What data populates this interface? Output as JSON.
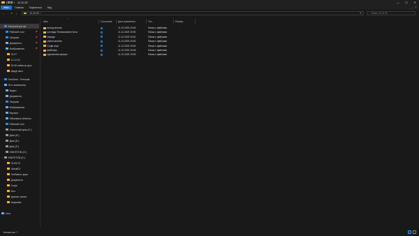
{
  "window": {
    "title": "11.12.23",
    "controls": [
      "—",
      "☐",
      "✕"
    ]
  },
  "ribbon": {
    "tabs": [
      "Файл",
      "Главная",
      "Поделиться",
      "Вид"
    ],
    "right_icons": [
      "chevron-down-icon",
      "help-icon"
    ]
  },
  "address": {
    "path": "11.12.23",
    "search_placeholder": "Поиск: 11.12.23"
  },
  "nav": {
    "items": [
      {
        "label": "Быстрый доступ",
        "icon": "star-icon",
        "color": "#3b8bd6",
        "selected": true,
        "pinned": false
      },
      {
        "label": "Рабочий стол",
        "icon": "desktop-icon",
        "color": "#3b8bd6",
        "pinned": true
      },
      {
        "label": "Загрузки",
        "icon": "download-icon",
        "color": "#3b8bd6",
        "pinned": true
      },
      {
        "label": "Документы",
        "icon": "document-icon",
        "color": "#9ab0c8",
        "pinned": true
      },
      {
        "label": "Изображения",
        "icon": "pictures-icon",
        "color": "#6fb0e0",
        "pinned": true
      },
      {
        "label": "02.07",
        "icon": "folder-icon",
        "color": "#e8b84a"
      },
      {
        "label": "11.12.23",
        "icon": "folder-icon",
        "color": "#e8b84a"
      },
      {
        "label": "30-30 инвестр русх",
        "icon": "folder-icon",
        "color": "#e8b84a"
      },
      {
        "label": "фиgф иксо",
        "icon": "folder-icon",
        "color": "#e8b84a"
      },
      {
        "label": "OneDrive - Personal",
        "icon": "cloud-icon",
        "color": "#3b8bd6"
      },
      {
        "label": "Этот компьютер",
        "icon": "computer-icon",
        "color": "#6fb0e0"
      },
      {
        "label": "Видео",
        "icon": "video-icon",
        "color": "#6fb0e0"
      },
      {
        "label": "Документы",
        "icon": "document-icon",
        "color": "#9ab0c8"
      },
      {
        "label": "Загрузки",
        "icon": "download-icon",
        "color": "#3b8bd6"
      },
      {
        "label": "Изображения",
        "icon": "pictures-icon",
        "color": "#6fb0e0"
      },
      {
        "label": "Музыка",
        "icon": "music-icon",
        "color": "#6fb0e0"
      },
      {
        "label": "Объемные объекты",
        "icon": "3d-objects-icon",
        "color": "#6fb0e0"
      },
      {
        "label": "Рабочий стол",
        "icon": "desktop-icon",
        "color": "#3b8bd6"
      },
      {
        "label": "Локальный диск (C:)",
        "icon": "drive-icon",
        "color": "#9a9a9a"
      },
      {
        "label": "Диск (D:)",
        "icon": "drive-icon",
        "color": "#9a9a9a"
      },
      {
        "label": "Диск (E:)",
        "icon": "drive-icon",
        "color": "#9a9a9a"
      },
      {
        "label": "Диск (F:)",
        "icon": "drive-icon",
        "color": "#9a9a9a"
      },
      {
        "label": "KINGSTON (G:)",
        "icon": "usb-drive-icon",
        "color": "#9a9a9a"
      },
      {
        "label": "KINGSTON (G:)",
        "icon": "usb-drive-icon",
        "color": "#9a9a9a"
      },
      {
        "label": "02.05.23",
        "icon": "folder-icon",
        "color": "#e8b84a"
      },
      {
        "label": "VirtualDJ",
        "icon": "folder-icon",
        "color": "#e8b84a"
      },
      {
        "label": "Глобакост доки",
        "icon": "folder-icon",
        "color": "#e8b84a"
      },
      {
        "label": "Документы",
        "icon": "folder-icon",
        "color": "#e8b84a"
      },
      {
        "label": "Софи",
        "icon": "folder-icon",
        "color": "#e8b84a"
      },
      {
        "label": "Фон",
        "icon": "folder-icon",
        "color": "#e8b84a"
      },
      {
        "label": "формат иатиа",
        "icon": "folder-icon",
        "color": "#e8b84a"
      },
      {
        "label": "Шорнами",
        "icon": "folder-icon",
        "color": "#e8b84a"
      },
      {
        "label": "Сеть",
        "icon": "network-icon",
        "color": "#6fb0e0"
      }
    ]
  },
  "columns": [
    "Имя",
    "Состояние",
    "Дата изменения",
    "Тип",
    "Размер"
  ],
  "files": [
    {
      "name": "выход витина",
      "date": "11.12.2023 19:49",
      "type": "Папка с файлами"
    },
    {
      "name": "колледж Техникаление Боги",
      "date": "11.12.2023 19:50",
      "type": "Папка с файлами"
    },
    {
      "name": "парада",
      "date": "11.12.2023 19:51",
      "type": "Папка с файлами"
    },
    {
      "name": "смена витина",
      "date": "11.12.2023 19:52",
      "type": "Папка с файлами"
    },
    {
      "name": "Софи игра",
      "date": "11.12.2023 19:54",
      "type": "Папка с файлами"
    },
    {
      "name": "файлоры",
      "date": "11.12.2023 19:46",
      "type": "Папка с файлами"
    },
    {
      "name": "церемония музыка",
      "date": "11.12.2023 19:53",
      "type": "Папка с файлами"
    }
  ],
  "status": {
    "text": "Элементов: 7"
  },
  "colors": {
    "background": "#191919",
    "accent": "#1f6fbf",
    "folder": "#e8b84a"
  }
}
